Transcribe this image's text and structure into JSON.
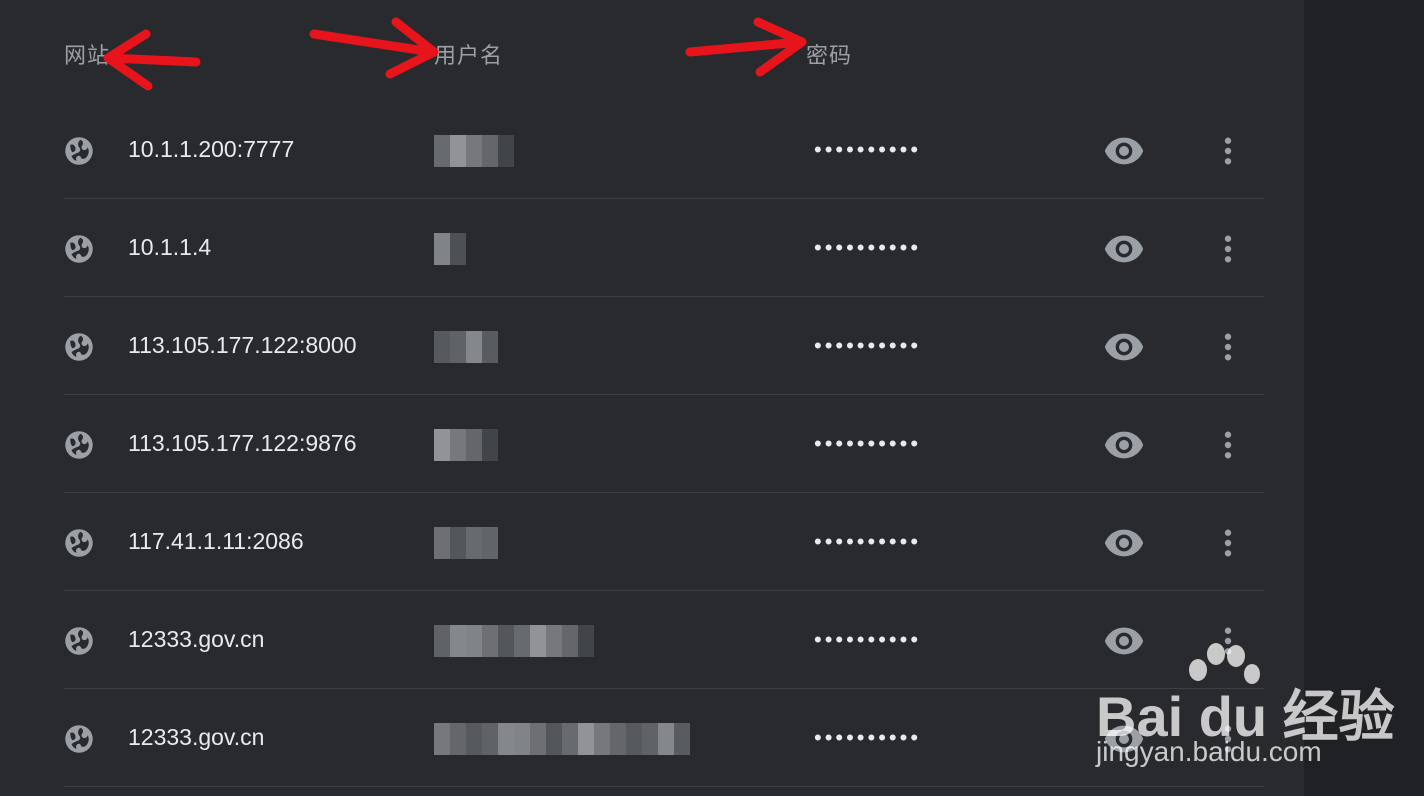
{
  "header": {
    "site_label": "网站",
    "username_label": "用户名",
    "password_label": "密码"
  },
  "rows": [
    {
      "site": "10.1.1.200:7777",
      "username": "",
      "password": "••••••••••",
      "username_blurred": true
    },
    {
      "site": "10.1.1.4",
      "username": "",
      "password": "••••••••••",
      "username_blurred": true
    },
    {
      "site": "113.105.177.122:8000",
      "username": "",
      "password": "••••••••••",
      "username_blurred": true
    },
    {
      "site": "113.105.177.122:9876",
      "username": "",
      "password": "••••••••••",
      "username_blurred": true
    },
    {
      "site": "117.41.1.11:2086",
      "username": "",
      "password": "••••••••••",
      "username_blurred": true
    },
    {
      "site": "12333.gov.cn",
      "username": "",
      "password": "••••••••••",
      "username_blurred": true
    },
    {
      "site": "12333.gov.cn",
      "username": "",
      "password": "••••••••••",
      "username_blurred": true
    }
  ],
  "icons": {
    "site": "globe-icon",
    "show_password": "eye-icon",
    "more": "more-vert-icon"
  },
  "annotations": {
    "arrow_color": "#e8141c"
  },
  "watermark": {
    "brand": "Bai du 经验",
    "url": "jingyan.baidu.com"
  },
  "colors": {
    "background": "#292a2d",
    "text_primary": "#e8eaed",
    "text_secondary": "#9aa0a6",
    "divider": "#3c4043"
  }
}
